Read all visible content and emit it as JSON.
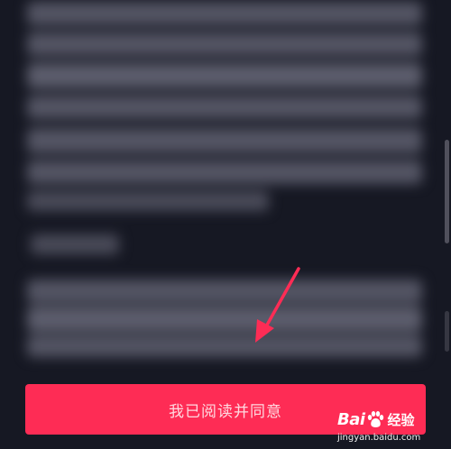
{
  "agreement": {
    "agree_button_label": "我已阅读并同意"
  },
  "watermark": {
    "brand_prefix": "Bai",
    "brand_suffix": "经验",
    "url": "jingyan.baidu.com"
  },
  "colors": {
    "background": "#161823",
    "accent": "#fe2c55",
    "arrow": "#fe2c55",
    "blurred_text": "#545564"
  },
  "icons": {
    "pointer": "annotation-arrow-icon",
    "logo": "baidu-paw-icon"
  }
}
